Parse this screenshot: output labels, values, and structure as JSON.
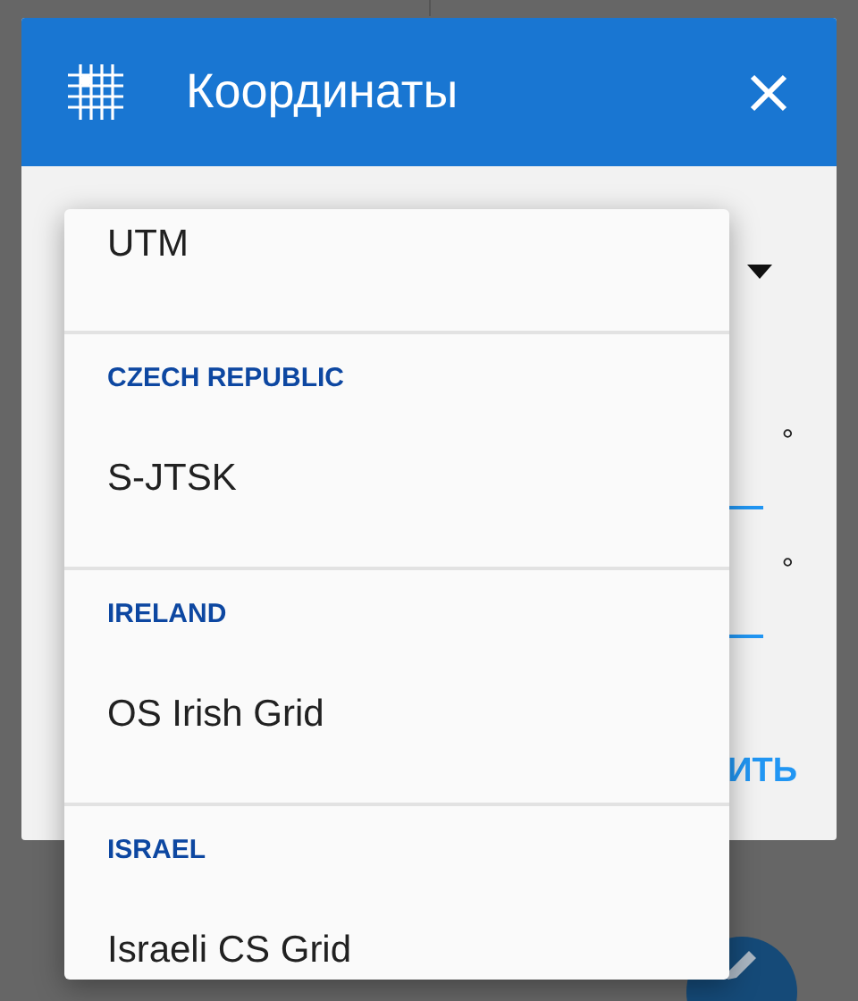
{
  "dialog": {
    "title": "Координаты",
    "fields": [
      {
        "unit": "°"
      },
      {
        "unit": "°"
      }
    ],
    "button": "ИТЬ"
  },
  "dropdown": {
    "expanded": true,
    "groups": [
      {
        "options": [
          "UTM"
        ]
      },
      {
        "header": "CZECH REPUBLIC",
        "options": [
          "S-JTSK"
        ]
      },
      {
        "header": "IRELAND",
        "options": [
          "OS Irish Grid"
        ]
      },
      {
        "header": "ISRAEL",
        "options": [
          "Israeli CS Grid"
        ]
      }
    ]
  }
}
